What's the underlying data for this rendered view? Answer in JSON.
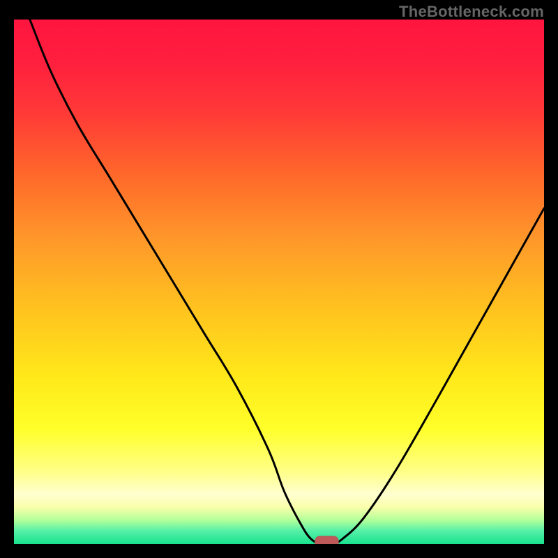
{
  "watermark": "TheBottleneck.com",
  "colors": {
    "black": "#000000",
    "curve": "#000000",
    "marker_fill": "#bf5a5a",
    "marker_stroke": "#b05858"
  },
  "gradient_stops": [
    {
      "offset": 0.0,
      "color": "#ff153f"
    },
    {
      "offset": 0.08,
      "color": "#ff1f3e"
    },
    {
      "offset": 0.18,
      "color": "#ff3a37"
    },
    {
      "offset": 0.3,
      "color": "#ff6a2a"
    },
    {
      "offset": 0.42,
      "color": "#ff982a"
    },
    {
      "offset": 0.55,
      "color": "#ffc21f"
    },
    {
      "offset": 0.68,
      "color": "#ffe81a"
    },
    {
      "offset": 0.78,
      "color": "#ffff2a"
    },
    {
      "offset": 0.86,
      "color": "#ffff85"
    },
    {
      "offset": 0.905,
      "color": "#ffffd0"
    },
    {
      "offset": 0.93,
      "color": "#f9ffaa"
    },
    {
      "offset": 0.955,
      "color": "#b0ff9a"
    },
    {
      "offset": 0.975,
      "color": "#55f0a8"
    },
    {
      "offset": 1.0,
      "color": "#18e28e"
    }
  ],
  "chart_data": {
    "type": "line",
    "title": "",
    "xlabel": "",
    "ylabel": "",
    "xlim": [
      0,
      100
    ],
    "ylim": [
      0,
      100
    ],
    "x": [
      3,
      7,
      12,
      18,
      24,
      30,
      36,
      42,
      48,
      51,
      54,
      56,
      58,
      60,
      62,
      66,
      72,
      80,
      90,
      100
    ],
    "values": [
      100,
      90,
      80,
      70,
      60,
      50,
      40,
      30,
      18,
      10,
      4,
      1,
      0,
      0,
      1,
      5,
      14,
      28,
      46,
      64
    ],
    "marker": {
      "x": 59,
      "y": 0,
      "rx": 2.2,
      "ry": 1.1
    }
  }
}
